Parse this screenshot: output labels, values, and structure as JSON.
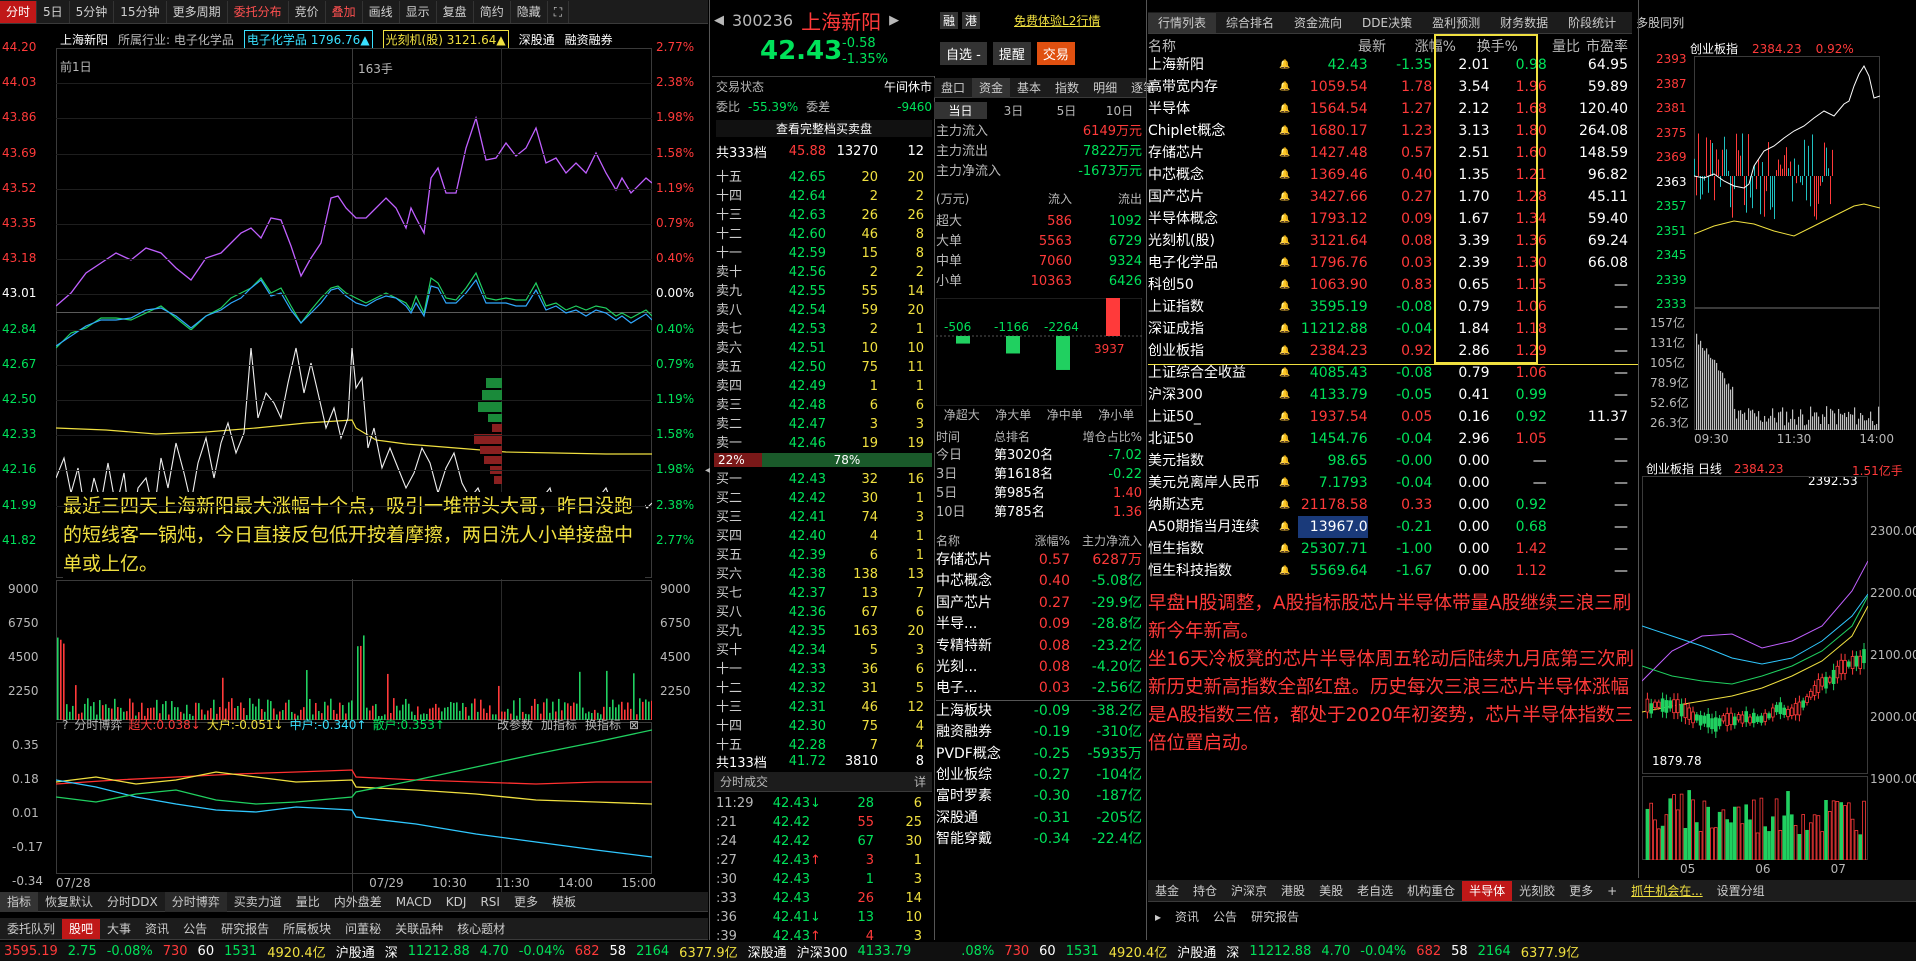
{
  "left_toolbar": {
    "items": [
      "分时",
      "5日",
      "5分钟",
      "15分钟",
      "更多周期",
      "委托分布",
      "竞价",
      "叠加",
      "画线",
      "显示",
      "复盘",
      "简约",
      "隐藏"
    ],
    "active": "分时"
  },
  "chart_header": {
    "name": "上海新阳",
    "industry": "所属行业: 电子化学品",
    "overlay1": "电子化学品 1796.76▲",
    "overlay2": "光刻机(股) 3121.64▲",
    "tags": [
      "深股通",
      "融资融券"
    ],
    "prev_day": "前1日",
    "hand": "163手"
  },
  "price_axis": {
    "left": [
      "44.20",
      "44.03",
      "43.86",
      "43.69",
      "43.52",
      "43.35",
      "43.18",
      "43.01",
      "42.84",
      "42.67",
      "42.50",
      "42.33",
      "42.16",
      "41.99",
      "41.82"
    ],
    "right": [
      "2.77%",
      "2.38%",
      "1.98%",
      "1.58%",
      "1.19%",
      "0.79%",
      "0.40%",
      "0.00%",
      "0.40%",
      "0.79%",
      "1.19%",
      "1.58%",
      "1.98%",
      "2.38%",
      "2.77%"
    ]
  },
  "vol_axis": {
    "left": [
      "9000",
      "6750",
      "4500",
      "2250"
    ],
    "right": [
      "9000",
      "6750",
      "4500",
      "2250"
    ]
  },
  "annotation_left": "最近三四天上海新阳最大涨幅十个点，吸引一堆带头大哥，昨日没跑的短线客一锅炖，今日直接反包低开按着摩擦，两日洗人小单接盘中单或上亿。",
  "game": {
    "title": "分时博弈",
    "super": "超大:0.038↓",
    "big": "大户:-0.051↓",
    "mid": "中户:-0.340↑",
    "small": "散户:0.353↑",
    "axis": [
      "0.35",
      "0.18",
      "0.01",
      "-0.17",
      "-0.34"
    ],
    "btns": [
      "改参数",
      "加指标",
      "换指标"
    ]
  },
  "time_axis": [
    "07/28",
    "07/29",
    "10:30",
    "11:30",
    "14:00",
    "15:00"
  ],
  "indicator_tabs": [
    "指标",
    "恢复默认",
    "分时DDX",
    "分时博弈",
    "买卖力道",
    "量比",
    "内外盘差",
    "MACD",
    "KDJ",
    "RSI",
    "更多",
    "模板"
  ],
  "bottom_tabs": [
    "委托队列",
    "股吧",
    "大事",
    "资讯",
    "公告",
    "研究报告",
    "所属板块",
    "问董秘",
    "关联品种",
    "核心题材"
  ],
  "stock": {
    "code": "300236",
    "name": "上海新阳",
    "tags": [
      "融",
      "港"
    ],
    "l2": "免费体验L2行情",
    "price": "42.43",
    "change": "-0.58",
    "pct": "-1.35%",
    "btn1": "自选 -",
    "btn2": "提醒",
    "btn3": "交易"
  },
  "status": {
    "label": "交易状态",
    "value": "午间休市",
    "weibi_l": "委比",
    "weibi": "-55.39%",
    "weicha_l": "委差",
    "weicha": "-9460",
    "link": "查看完整档买卖盘"
  },
  "sell_total": {
    "label": "共333档",
    "price": "45.88",
    "vol": "13270",
    "n": "12"
  },
  "sells": [
    [
      "十五",
      "42.65",
      "20",
      "20"
    ],
    [
      "十四",
      "42.64",
      "2",
      "2"
    ],
    [
      "十三",
      "42.63",
      "26",
      "26"
    ],
    [
      "十二",
      "42.60",
      "46",
      "8"
    ],
    [
      "十一",
      "42.59",
      "15",
      "8"
    ],
    [
      "卖十",
      "42.56",
      "2",
      "2"
    ],
    [
      "卖九",
      "42.55",
      "55",
      "14"
    ],
    [
      "卖八",
      "42.54",
      "59",
      "20"
    ],
    [
      "卖七",
      "42.53",
      "2",
      "1"
    ],
    [
      "卖六",
      "42.51",
      "10",
      "10"
    ],
    [
      "卖五",
      "42.50",
      "75",
      "11"
    ],
    [
      "卖四",
      "42.49",
      "1",
      "1"
    ],
    [
      "卖三",
      "42.48",
      "6",
      "6"
    ],
    [
      "卖二",
      "42.47",
      "3",
      "3"
    ],
    [
      "卖一",
      "42.46",
      "19",
      "19"
    ]
  ],
  "ratio": {
    "left": "22%",
    "right": "78%"
  },
  "buys": [
    [
      "买一",
      "42.43",
      "32",
      "16"
    ],
    [
      "买二",
      "42.42",
      "30",
      "1"
    ],
    [
      "买三",
      "42.41",
      "74",
      "3"
    ],
    [
      "买四",
      "42.40",
      "4",
      "1"
    ],
    [
      "买五",
      "42.39",
      "6",
      "1"
    ],
    [
      "买六",
      "42.38",
      "138",
      "13"
    ],
    [
      "买七",
      "42.37",
      "13",
      "7"
    ],
    [
      "买八",
      "42.36",
      "67",
      "6"
    ],
    [
      "买九",
      "42.35",
      "163",
      "20"
    ],
    [
      "买十",
      "42.34",
      "5",
      "3"
    ],
    [
      "十一",
      "42.33",
      "36",
      "6"
    ],
    [
      "十二",
      "42.32",
      "31",
      "5"
    ],
    [
      "十三",
      "42.31",
      "46",
      "12"
    ],
    [
      "十四",
      "42.30",
      "75",
      "4"
    ],
    [
      "十五",
      "42.28",
      "7",
      "4"
    ]
  ],
  "buy_total": {
    "label": "共133档",
    "price": "41.72",
    "vol": "3810",
    "n": "8"
  },
  "ticks_title": "分时成交",
  "ticks_more": "详",
  "ticks": [
    [
      "11:29",
      "42.43",
      "↓",
      "28",
      "6"
    ],
    [
      ":21",
      "42.42",
      "",
      "55",
      "25"
    ],
    [
      ":24",
      "42.42",
      "",
      "67",
      "30"
    ],
    [
      ":27",
      "42.43",
      "↑",
      "3",
      "1"
    ],
    [
      ":30",
      "42.43",
      "",
      "1",
      "3"
    ],
    [
      ":33",
      "42.43",
      "",
      "26",
      "14"
    ],
    [
      ":36",
      "42.41",
      "↓",
      "13",
      "10"
    ],
    [
      ":39",
      "42.43",
      "↑",
      "4",
      "3"
    ]
  ],
  "fund": {
    "tabs": [
      "盘口",
      "资金",
      "基本",
      "指数",
      "明细",
      "逐笔"
    ],
    "periods": [
      "当日",
      "3日",
      "5日",
      "10日"
    ],
    "flow": [
      [
        "主力流入",
        "6149万元"
      ],
      [
        "主力流出",
        "7822万元"
      ],
      [
        "主力净流入",
        "-1673万元"
      ]
    ],
    "hdr": [
      "(万元)",
      "流入",
      "流出"
    ],
    "table": [
      [
        "超大",
        "586",
        "1092"
      ],
      [
        "大单",
        "5563",
        "6729"
      ],
      [
        "中单",
        "7060",
        "9324"
      ],
      [
        "小单",
        "10363",
        "6426"
      ]
    ],
    "bars": [
      {
        "label": "净超大",
        "val": "-506",
        "v": -506
      },
      {
        "label": "净大单",
        "val": "-1166",
        "v": -1166
      },
      {
        "label": "净中单",
        "val": "-2264",
        "v": -2264
      },
      {
        "label": "净小单",
        "val": "3937",
        "v": 3937
      }
    ],
    "rank_hdr": [
      "时间",
      "总排名",
      "增仓占比%"
    ],
    "rank": [
      [
        "今日",
        "第3020名",
        "-7.02"
      ],
      [
        "3日",
        "第1618名",
        "-0.22"
      ],
      [
        "5日",
        "第985名",
        "1.40"
      ],
      [
        "10日",
        "第785名",
        "1.36"
      ]
    ],
    "sector_hdr": [
      "名称",
      "涨幅%",
      "主力净流入"
    ],
    "sectors": [
      [
        "存储芯片",
        "0.57",
        "6287万"
      ],
      [
        "中芯概念",
        "0.40",
        "-5.08亿"
      ],
      [
        "国产芯片",
        "0.27",
        "-29.9亿"
      ],
      [
        "半导...",
        "0.09",
        "-28.8亿"
      ],
      [
        "专精特新",
        "0.08",
        "-23.2亿"
      ],
      [
        "光刻...",
        "0.08",
        "-4.20亿"
      ],
      [
        "电子...",
        "0.03",
        "-2.56亿"
      ],
      [
        "上海板块",
        "-0.09",
        "-38.2亿"
      ],
      [
        "融资融券",
        "-0.19",
        "-310亿"
      ],
      [
        "PVDF概念",
        "-0.25",
        "-5935万"
      ],
      [
        "创业板综",
        "-0.27",
        "-104亿"
      ],
      [
        "富时罗素",
        "-0.30",
        "-187亿"
      ],
      [
        "深股通",
        "-0.31",
        "-205亿"
      ],
      [
        "智能穿戴",
        "-0.34",
        "-22.4亿"
      ]
    ]
  },
  "right_tabs": [
    "行情列表",
    "综合排名",
    "资金流向",
    "DDE决策",
    "盈利预测",
    "财务数据",
    "阶段统计",
    "多股同列"
  ],
  "list_hdr": [
    "名称",
    "最新",
    "涨幅%",
    "换手%",
    "量比",
    "市盈率"
  ],
  "list": [
    [
      "上海新阳",
      "42.43",
      "-1.35",
      "2.01",
      "0.98",
      "64.95"
    ],
    [
      "高带宽内存",
      "1059.54",
      "1.78",
      "3.54",
      "1.96",
      "59.89"
    ],
    [
      "半导体",
      "1564.54",
      "1.27",
      "2.12",
      "1.68",
      "120.40"
    ],
    [
      "Chiplet概念",
      "1680.17",
      "1.23",
      "3.13",
      "1.80",
      "264.08"
    ],
    [
      "存储芯片",
      "1427.48",
      "0.57",
      "2.51",
      "1.60",
      "148.59"
    ],
    [
      "中芯概念",
      "1369.46",
      "0.40",
      "1.35",
      "1.21",
      "96.82"
    ],
    [
      "国产芯片",
      "3427.66",
      "0.27",
      "1.70",
      "1.28",
      "45.11"
    ],
    [
      "半导体概念",
      "1793.12",
      "0.09",
      "1.67",
      "1.34",
      "59.40"
    ],
    [
      "光刻机(股)",
      "3121.64",
      "0.08",
      "3.39",
      "1.36",
      "69.24"
    ],
    [
      "电子化学品",
      "1796.76",
      "0.03",
      "2.39",
      "1.30",
      "66.08"
    ],
    [
      "科创50",
      "1063.90",
      "0.83",
      "0.65",
      "1.15",
      "—"
    ],
    [
      "上证指数",
      "3595.19",
      "-0.08",
      "0.79",
      "1.06",
      "—"
    ],
    [
      "深证成指",
      "11212.88",
      "-0.04",
      "1.84",
      "1.18",
      "—"
    ],
    [
      "创业板指",
      "2384.23",
      "0.92",
      "2.86",
      "1.29",
      "—"
    ],
    [
      "上证综合全收益",
      "4085.43",
      "-0.08",
      "0.79",
      "1.06",
      "—"
    ],
    [
      "沪深300",
      "4133.79",
      "-0.05",
      "0.41",
      "0.99",
      "—"
    ],
    [
      "上证50_",
      "1937.54",
      "0.05",
      "0.16",
      "0.92",
      "11.37"
    ],
    [
      "北证50",
      "1454.76",
      "-0.04",
      "2.96",
      "1.05",
      "—"
    ],
    [
      "美元指数",
      "98.65",
      "-0.00",
      "0.00",
      "—",
      "—"
    ],
    [
      "美元兑离岸人民币",
      "7.1793",
      "-0.04",
      "0.00",
      "—",
      "—"
    ],
    [
      "纳斯达克",
      "21178.58",
      "0.33",
      "0.00",
      "0.92",
      "—"
    ],
    [
      "A50期指当月连续",
      "13967.0",
      "-0.21",
      "0.00",
      "0.68",
      "—"
    ],
    [
      "恒生指数",
      "25307.71",
      "-1.00",
      "0.00",
      "1.42",
      "—"
    ],
    [
      "恒生科技指数",
      "5569.64",
      "-1.67",
      "0.00",
      "1.12",
      "—"
    ]
  ],
  "annotation_right": "早盘H股调整，A股指标股芯片半导体带量A股继续三浪三刷新今年新高。\n坐16天冷板凳的芯片半导体周五轮动后陆续九月底第三次刷新历史新高指数全部红盘。历史每次三浪三芯片半导体涨幅是A股指数三倍，都处于2020年初姿势，芯片半导体指数三倍位置启动。",
  "list_bottom_tabs": [
    "基金",
    "持仓",
    "沪深京",
    "港股",
    "美股",
    "老自选",
    "机构重仓",
    "半导体",
    "光刻胶",
    "更多",
    "+",
    "抓牛机会在...",
    "设置分组"
  ],
  "list_bottom_active": "半导体",
  "list_sub_tabs": [
    "资讯",
    "公告",
    "研究报告"
  ],
  "mini": {
    "title": "创业板指",
    "price": "2384.23",
    "pct": "0.92%",
    "axis": [
      "2393",
      "2387",
      "2381",
      "2375",
      "2369",
      "2363",
      "2357",
      "2351",
      "2345",
      "2339",
      "2333"
    ],
    "vol_axis": [
      "157亿",
      "131亿",
      "105亿",
      "78.9亿",
      "52.6亿",
      "26.3亿"
    ],
    "times": [
      "09:30",
      "11:30",
      "14:00"
    ]
  },
  "daily": {
    "title": "创业板指 日线",
    "price": "2384.23",
    "vol": "1.51亿手",
    "high": "2392.53",
    "low": "1879.78",
    "axis": [
      "2300.00",
      "2200.00",
      "2100.00",
      "2000.00",
      "1900.00"
    ],
    "months": [
      "05",
      "06",
      "07"
    ]
  },
  "status_bar": {
    "left": "3595.19",
    "l_chg": "2.75",
    "l_pct": "-0.08%",
    "n1": "730",
    "n2": "60",
    "n3": "1531",
    "amt": "4920.4亿",
    "hgt": "沪股通",
    "sz": "深",
    "sz_v": "11212.88",
    "sz_chg": "4.70",
    "sz_pct": "-0.04%",
    "m1": "682",
    "m2": "58",
    "m3": "2164",
    "amt2": "6377.9亿",
    "sgt": "深股通",
    "hs": "沪深300",
    "hs_v": "4133.79",
    "r_pct": ".08%",
    "r_hgt": "沪股通"
  },
  "colors": {
    "up": "#ff3a3a",
    "down": "#00e25a",
    "accent": "#c01818",
    "yellow": "#f0e040"
  }
}
